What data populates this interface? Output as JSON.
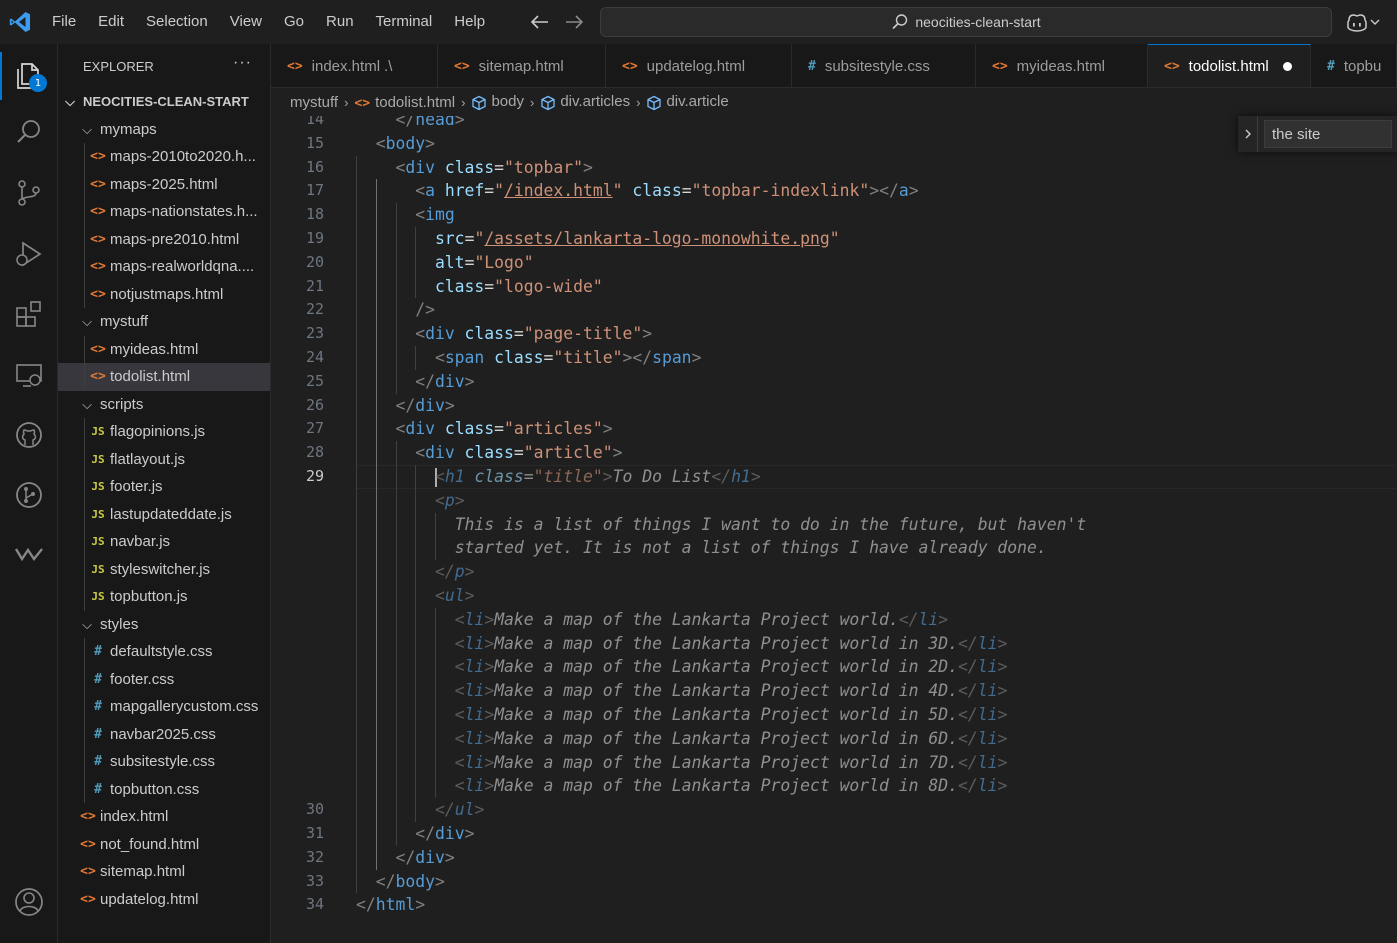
{
  "menubar": {
    "items": [
      "File",
      "Edit",
      "Selection",
      "View",
      "Go",
      "Run",
      "Terminal",
      "Help"
    ]
  },
  "command_center": {
    "text": "neocities-clean-start"
  },
  "activity_bar": {
    "explorer_badge": "1",
    "icons": [
      "files-icon",
      "search-icon",
      "source-control-icon",
      "run-debug-icon",
      "extensions-icon",
      "remote-explorer-icon",
      "github-icon",
      "git-graph-icon",
      "wakatime-icon",
      "account-icon"
    ]
  },
  "sidebar": {
    "title": "EXPLORER",
    "more": "···",
    "root": "NEOCITIES-CLEAN-START",
    "tree": [
      {
        "label": "mymaps",
        "type": "folder",
        "depth": 1
      },
      {
        "label": "maps-2010to2020.h...",
        "type": "html",
        "depth": 2
      },
      {
        "label": "maps-2025.html",
        "type": "html",
        "depth": 2
      },
      {
        "label": "maps-nationstates.h...",
        "type": "html",
        "depth": 2
      },
      {
        "label": "maps-pre2010.html",
        "type": "html",
        "depth": 2
      },
      {
        "label": "maps-realworldqna....",
        "type": "html",
        "depth": 2
      },
      {
        "label": "notjustmaps.html",
        "type": "html",
        "depth": 2
      },
      {
        "label": "mystuff",
        "type": "folder",
        "depth": 1
      },
      {
        "label": "myideas.html",
        "type": "html",
        "depth": 2
      },
      {
        "label": "todolist.html",
        "type": "html",
        "depth": 2,
        "selected": true
      },
      {
        "label": "scripts",
        "type": "folder",
        "depth": 1
      },
      {
        "label": "flagopinions.js",
        "type": "js",
        "depth": 2
      },
      {
        "label": "flatlayout.js",
        "type": "js",
        "depth": 2
      },
      {
        "label": "footer.js",
        "type": "js",
        "depth": 2
      },
      {
        "label": "lastupdateddate.js",
        "type": "js",
        "depth": 2
      },
      {
        "label": "navbar.js",
        "type": "js",
        "depth": 2
      },
      {
        "label": "styleswitcher.js",
        "type": "js",
        "depth": 2
      },
      {
        "label": "topbutton.js",
        "type": "js",
        "depth": 2
      },
      {
        "label": "styles",
        "type": "folder",
        "depth": 1
      },
      {
        "label": "defaultstyle.css",
        "type": "css",
        "depth": 2
      },
      {
        "label": "footer.css",
        "type": "css",
        "depth": 2
      },
      {
        "label": "mapgallerycustom.css",
        "type": "css",
        "depth": 2
      },
      {
        "label": "navbar2025.css",
        "type": "css",
        "depth": 2
      },
      {
        "label": "subsitestyle.css",
        "type": "css",
        "depth": 2
      },
      {
        "label": "topbutton.css",
        "type": "css",
        "depth": 2
      },
      {
        "label": "index.html",
        "type": "html",
        "depth": 1
      },
      {
        "label": "not_found.html",
        "type": "html",
        "depth": 1
      },
      {
        "label": "sitemap.html",
        "type": "html",
        "depth": 1
      },
      {
        "label": "updatelog.html",
        "type": "html",
        "depth": 1
      }
    ]
  },
  "tabs": [
    {
      "label": "index.html",
      "suffix": ".\\",
      "type": "html"
    },
    {
      "label": "sitemap.html",
      "type": "html"
    },
    {
      "label": "updatelog.html",
      "type": "html"
    },
    {
      "label": "subsitestyle.css",
      "type": "css"
    },
    {
      "label": "myideas.html",
      "type": "html"
    },
    {
      "label": "todolist.html",
      "type": "html",
      "active": true,
      "dirty": true
    },
    {
      "label": "topbu",
      "type": "css"
    }
  ],
  "breadcrumbs": [
    "mystuff",
    "todolist.html",
    "body",
    "div.articles",
    "div.article"
  ],
  "find_widget": {
    "value": "the site"
  },
  "editor": {
    "current_line": "29",
    "line_numbers": [
      "14",
      "15",
      "16",
      "17",
      "18",
      "19",
      "20",
      "21",
      "22",
      "23",
      "24",
      "25",
      "26",
      "27",
      "28",
      "29",
      "",
      "",
      "",
      "",
      "",
      "",
      "",
      "",
      "",
      "",
      "",
      "",
      "",
      "30",
      "31",
      "32",
      "33",
      "34"
    ],
    "lines": [
      [
        {
          "c": "p",
          "t": "    </"
        },
        {
          "c": "t",
          "t": "head"
        },
        {
          "c": "p",
          "t": ">"
        }
      ],
      [
        {
          "c": "p",
          "t": "  <"
        },
        {
          "c": "t",
          "t": "body"
        },
        {
          "c": "p",
          "t": ">"
        }
      ],
      [
        {
          "c": "p",
          "t": "    <"
        },
        {
          "c": "t",
          "t": "div"
        },
        {
          "c": "a",
          "t": " class"
        },
        {
          "c": "txt",
          "t": "="
        },
        {
          "c": "s",
          "t": "\"topbar\""
        },
        {
          "c": "p",
          "t": ">"
        }
      ],
      [
        {
          "c": "p",
          "t": "      <"
        },
        {
          "c": "t",
          "t": "a"
        },
        {
          "c": "a",
          "t": " href"
        },
        {
          "c": "txt",
          "t": "="
        },
        {
          "c": "s",
          "t": "\""
        },
        {
          "c": "u",
          "t": "/index.html"
        },
        {
          "c": "s",
          "t": "\""
        },
        {
          "c": "a",
          "t": " class"
        },
        {
          "c": "txt",
          "t": "="
        },
        {
          "c": "s",
          "t": "\"topbar-indexlink\""
        },
        {
          "c": "p",
          "t": "></"
        },
        {
          "c": "t",
          "t": "a"
        },
        {
          "c": "p",
          "t": ">"
        }
      ],
      [
        {
          "c": "p",
          "t": "      <"
        },
        {
          "c": "t",
          "t": "img"
        }
      ],
      [
        {
          "c": "a",
          "t": "        src"
        },
        {
          "c": "txt",
          "t": "="
        },
        {
          "c": "s",
          "t": "\""
        },
        {
          "c": "u",
          "t": "/assets/lankarta-logo-monowhite.png"
        },
        {
          "c": "s",
          "t": "\""
        }
      ],
      [
        {
          "c": "a",
          "t": "        alt"
        },
        {
          "c": "txt",
          "t": "="
        },
        {
          "c": "s",
          "t": "\"Logo\""
        }
      ],
      [
        {
          "c": "a",
          "t": "        class"
        },
        {
          "c": "txt",
          "t": "="
        },
        {
          "c": "s",
          "t": "\"logo-wide\""
        }
      ],
      [
        {
          "c": "p",
          "t": "      />"
        }
      ],
      [
        {
          "c": "p",
          "t": "      <"
        },
        {
          "c": "t",
          "t": "div"
        },
        {
          "c": "a",
          "t": " class"
        },
        {
          "c": "txt",
          "t": "="
        },
        {
          "c": "s",
          "t": "\"page-title\""
        },
        {
          "c": "p",
          "t": ">"
        }
      ],
      [
        {
          "c": "p",
          "t": "        <"
        },
        {
          "c": "t",
          "t": "span"
        },
        {
          "c": "a",
          "t": " class"
        },
        {
          "c": "txt",
          "t": "="
        },
        {
          "c": "s",
          "t": "\"title\""
        },
        {
          "c": "p",
          "t": "></"
        },
        {
          "c": "t",
          "t": "span"
        },
        {
          "c": "p",
          "t": ">"
        }
      ],
      [
        {
          "c": "p",
          "t": "      </"
        },
        {
          "c": "t",
          "t": "div"
        },
        {
          "c": "p",
          "t": ">"
        }
      ],
      [
        {
          "c": "p",
          "t": "    </"
        },
        {
          "c": "t",
          "t": "div"
        },
        {
          "c": "p",
          "t": ">"
        }
      ],
      [
        {
          "c": "p",
          "t": "    <"
        },
        {
          "c": "t",
          "t": "div"
        },
        {
          "c": "a",
          "t": " class"
        },
        {
          "c": "txt",
          "t": "="
        },
        {
          "c": "s",
          "t": "\"articles\""
        },
        {
          "c": "p",
          "t": ">"
        }
      ],
      [
        {
          "c": "p",
          "t": "      <"
        },
        {
          "c": "t",
          "t": "div"
        },
        {
          "c": "a",
          "t": " class"
        },
        {
          "c": "txt",
          "t": "="
        },
        {
          "c": "s",
          "t": "\"article\""
        },
        {
          "c": "p",
          "t": ">"
        }
      ],
      [
        {
          "c": "txt",
          "t": "        "
        },
        {
          "c": "caret",
          "t": ""
        },
        {
          "c": "p dim",
          "t": "<"
        },
        {
          "c": "t dim",
          "t": "h1"
        },
        {
          "c": "a dim",
          "t": " class"
        },
        {
          "c": "txt dim",
          "t": "="
        },
        {
          "c": "s dim",
          "t": "\"title\""
        },
        {
          "c": "p dim",
          "t": ">"
        },
        {
          "c": "txt dim",
          "t": "To Do List"
        },
        {
          "c": "p dim",
          "t": "</"
        },
        {
          "c": "t dim",
          "t": "h1"
        },
        {
          "c": "p dim",
          "t": ">"
        }
      ],
      [
        {
          "c": "txt",
          "t": "        "
        },
        {
          "c": "p dim",
          "t": "<"
        },
        {
          "c": "t dim",
          "t": "p"
        },
        {
          "c": "p dim",
          "t": ">"
        }
      ],
      [
        {
          "c": "txt",
          "t": "          "
        },
        {
          "c": "txt dim",
          "t": "This is a list of things I want to do in the future, but haven't"
        }
      ],
      [
        {
          "c": "txt",
          "t": "          "
        },
        {
          "c": "txt dim",
          "t": "started yet. It is not a list of things I have already done."
        }
      ],
      [
        {
          "c": "txt",
          "t": "        "
        },
        {
          "c": "p dim",
          "t": "</"
        },
        {
          "c": "t dim",
          "t": "p"
        },
        {
          "c": "p dim",
          "t": ">"
        }
      ],
      [
        {
          "c": "txt",
          "t": "        "
        },
        {
          "c": "p dim",
          "t": "<"
        },
        {
          "c": "t dim",
          "t": "ul"
        },
        {
          "c": "p dim",
          "t": ">"
        }
      ],
      [
        {
          "c": "txt",
          "t": "          "
        },
        {
          "c": "p dim",
          "t": "<"
        },
        {
          "c": "t dim",
          "t": "li"
        },
        {
          "c": "p dim",
          "t": ">"
        },
        {
          "c": "txt dim",
          "t": "Make a map of the Lankarta Project world."
        },
        {
          "c": "p dim",
          "t": "</"
        },
        {
          "c": "t dim",
          "t": "li"
        },
        {
          "c": "p dim",
          "t": ">"
        }
      ],
      [
        {
          "c": "txt",
          "t": "          "
        },
        {
          "c": "p dim",
          "t": "<"
        },
        {
          "c": "t dim",
          "t": "li"
        },
        {
          "c": "p dim",
          "t": ">"
        },
        {
          "c": "txt dim",
          "t": "Make a map of the Lankarta Project world in 3D."
        },
        {
          "c": "p dim",
          "t": "</"
        },
        {
          "c": "t dim",
          "t": "li"
        },
        {
          "c": "p dim",
          "t": ">"
        }
      ],
      [
        {
          "c": "txt",
          "t": "          "
        },
        {
          "c": "p dim",
          "t": "<"
        },
        {
          "c": "t dim",
          "t": "li"
        },
        {
          "c": "p dim",
          "t": ">"
        },
        {
          "c": "txt dim",
          "t": "Make a map of the Lankarta Project world in 2D."
        },
        {
          "c": "p dim",
          "t": "</"
        },
        {
          "c": "t dim",
          "t": "li"
        },
        {
          "c": "p dim",
          "t": ">"
        }
      ],
      [
        {
          "c": "txt",
          "t": "          "
        },
        {
          "c": "p dim",
          "t": "<"
        },
        {
          "c": "t dim",
          "t": "li"
        },
        {
          "c": "p dim",
          "t": ">"
        },
        {
          "c": "txt dim",
          "t": "Make a map of the Lankarta Project world in 4D."
        },
        {
          "c": "p dim",
          "t": "</"
        },
        {
          "c": "t dim",
          "t": "li"
        },
        {
          "c": "p dim",
          "t": ">"
        }
      ],
      [
        {
          "c": "txt",
          "t": "          "
        },
        {
          "c": "p dim",
          "t": "<"
        },
        {
          "c": "t dim",
          "t": "li"
        },
        {
          "c": "p dim",
          "t": ">"
        },
        {
          "c": "txt dim",
          "t": "Make a map of the Lankarta Project world in 5D."
        },
        {
          "c": "p dim",
          "t": "</"
        },
        {
          "c": "t dim",
          "t": "li"
        },
        {
          "c": "p dim",
          "t": ">"
        }
      ],
      [
        {
          "c": "txt",
          "t": "          "
        },
        {
          "c": "p dim",
          "t": "<"
        },
        {
          "c": "t dim",
          "t": "li"
        },
        {
          "c": "p dim",
          "t": ">"
        },
        {
          "c": "txt dim",
          "t": "Make a map of the Lankarta Project world in 6D."
        },
        {
          "c": "p dim",
          "t": "</"
        },
        {
          "c": "t dim",
          "t": "li"
        },
        {
          "c": "p dim",
          "t": ">"
        }
      ],
      [
        {
          "c": "txt",
          "t": "          "
        },
        {
          "c": "p dim",
          "t": "<"
        },
        {
          "c": "t dim",
          "t": "li"
        },
        {
          "c": "p dim",
          "t": ">"
        },
        {
          "c": "txt dim",
          "t": "Make a map of the Lankarta Project world in 7D."
        },
        {
          "c": "p dim",
          "t": "</"
        },
        {
          "c": "t dim",
          "t": "li"
        },
        {
          "c": "p dim",
          "t": ">"
        }
      ],
      [
        {
          "c": "txt",
          "t": "          "
        },
        {
          "c": "p dim",
          "t": "<"
        },
        {
          "c": "t dim",
          "t": "li"
        },
        {
          "c": "p dim",
          "t": ">"
        },
        {
          "c": "txt dim",
          "t": "Make a map of the Lankarta Project world in 8D."
        },
        {
          "c": "p dim",
          "t": "</"
        },
        {
          "c": "t dim",
          "t": "li"
        },
        {
          "c": "p dim",
          "t": ">"
        }
      ],
      [
        {
          "c": "txt",
          "t": "        "
        },
        {
          "c": "p dim",
          "t": "</"
        },
        {
          "c": "t dim",
          "t": "ul"
        },
        {
          "c": "p dim",
          "t": ">"
        }
      ],
      [
        {
          "c": "p",
          "t": "      </"
        },
        {
          "c": "t",
          "t": "div"
        },
        {
          "c": "p",
          "t": ">"
        }
      ],
      [
        {
          "c": "p",
          "t": "    </"
        },
        {
          "c": "t",
          "t": "div"
        },
        {
          "c": "p",
          "t": ">"
        }
      ],
      [
        {
          "c": "p",
          "t": "  </"
        },
        {
          "c": "t",
          "t": "body"
        },
        {
          "c": "p",
          "t": ">"
        }
      ],
      [
        {
          "c": "p",
          "t": "</"
        },
        {
          "c": "t",
          "t": "html"
        },
        {
          "c": "p",
          "t": ">"
        }
      ],
      []
    ]
  },
  "colors": {
    "accent": "#0078d4",
    "html_icon": "#e37933",
    "js_icon": "#cbcb41",
    "css_icon": "#519aba"
  }
}
